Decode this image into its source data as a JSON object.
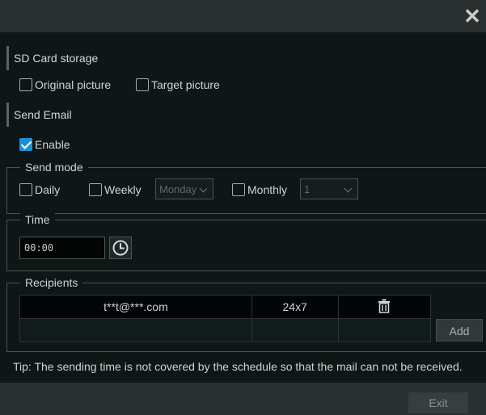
{
  "dialog": {
    "close_symbol": "✕"
  },
  "sd_card": {
    "label": "SD Card storage",
    "original_picture": {
      "label": "Original picture",
      "checked": false
    },
    "target_picture": {
      "label": "Target picture",
      "checked": false
    }
  },
  "send_email": {
    "label": "Send Email",
    "enable": {
      "label": "Enable",
      "checked": true
    }
  },
  "send_mode": {
    "legend": "Send mode",
    "daily": {
      "label": "Daily",
      "checked": false
    },
    "weekly": {
      "label": "Weekly",
      "checked": false
    },
    "weekly_day": "Monday",
    "monthly": {
      "label": "Monthly",
      "checked": false
    },
    "monthly_day": "1"
  },
  "time": {
    "legend": "Time",
    "value": "00:00",
    "icon": "clock-icon"
  },
  "recipients": {
    "legend": "Recipients",
    "rows": [
      {
        "email": "t**t@***.com",
        "schedule": "24x7",
        "action_icon": "trash-icon"
      },
      {
        "email": "",
        "schedule": "",
        "action_icon": ""
      }
    ],
    "add_label": "Add"
  },
  "tip": "Tip: The sending time is not covered by the schedule so that the mail can not be received.",
  "footer": {
    "exit_label": "Exit"
  },
  "colors": {
    "accent": "#1e8fd6",
    "background": "#0e1616",
    "titlebar": "#2a302f"
  }
}
